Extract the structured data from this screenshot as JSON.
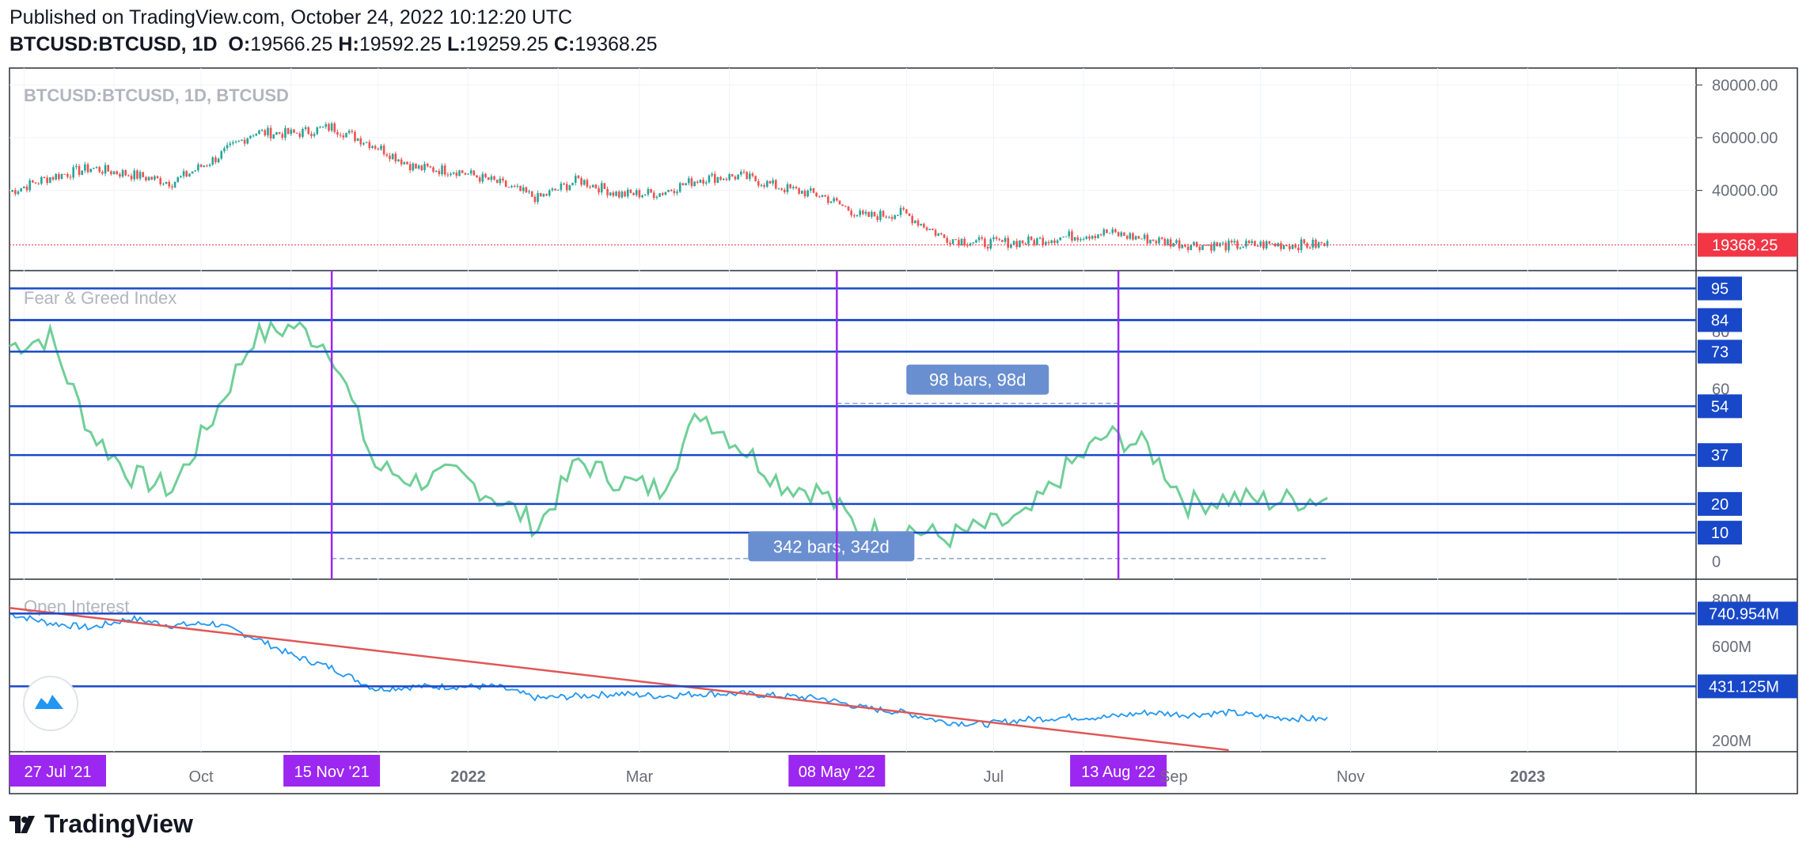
{
  "header": {
    "published": "Published on TradingView.com, October 24, 2022 10:12:20 UTC",
    "symbol": "BTCUSD:BTCUSD, 1D",
    "o_label": "O:",
    "o_value": "19566.25",
    "h_label": "H:",
    "h_value": "19592.25",
    "l_label": "L:",
    "l_value": "19259.25",
    "c_label": "C:",
    "c_value": "19368.25"
  },
  "footer": {
    "brand": "TradingView"
  },
  "colors": {
    "up": "#26a69a",
    "down": "#ef5350",
    "fg_line": "#6fcf97",
    "oi_line": "#2196f3",
    "hline": "#1848c8",
    "vline": "#9c27f0",
    "trend": "#e05656",
    "range_label": "#6a8fd0",
    "price_tag": "#f23645"
  },
  "chart_data": [
    {
      "type": "candlestick",
      "title": "BTCUSD:BTCUSD, 1D, BTCUSD",
      "y_ticks": [
        "80000.00",
        "60000.00",
        "40000.00"
      ],
      "ylim": [
        12000,
        84000
      ],
      "last_price": "19368.25",
      "x": [
        "2021-07-27",
        "2021-08-10",
        "2021-08-24",
        "2021-09-07",
        "2021-09-21",
        "2021-10-05",
        "2021-10-19",
        "2021-11-02",
        "2021-11-15",
        "2021-11-30",
        "2021-12-14",
        "2021-12-28",
        "2022-01-11",
        "2022-01-25",
        "2022-02-08",
        "2022-02-22",
        "2022-03-08",
        "2022-03-22",
        "2022-04-05",
        "2022-04-19",
        "2022-05-03",
        "2022-05-17",
        "2022-05-31",
        "2022-06-14",
        "2022-06-28",
        "2022-07-12",
        "2022-07-26",
        "2022-08-09",
        "2022-08-23",
        "2022-09-06",
        "2022-09-20",
        "2022-10-04",
        "2022-10-24"
      ],
      "close": [
        39500,
        45000,
        48500,
        46000,
        43000,
        51500,
        62000,
        61500,
        64000,
        57000,
        48500,
        47500,
        43000,
        37000,
        44000,
        38500,
        39000,
        44500,
        45500,
        41000,
        38000,
        30000,
        31500,
        22000,
        20000,
        20500,
        22500,
        24000,
        21500,
        19500,
        19000,
        19500,
        19368
      ]
    },
    {
      "type": "line",
      "title": "Fear & Greed Index",
      "y_ticks": [
        "80",
        "60",
        "0"
      ],
      "ylim": [
        -4,
        99
      ],
      "hlines": [
        "95",
        "84",
        "84",
        "73",
        "54",
        "37",
        "20",
        "10"
      ],
      "measurements": [
        "98 bars, 98d",
        "342 bars, 342d"
      ],
      "x": [
        "2021-07-27",
        "2021-08-10",
        "2021-08-24",
        "2021-09-07",
        "2021-09-21",
        "2021-10-05",
        "2021-10-19",
        "2021-11-02",
        "2021-11-15",
        "2021-11-30",
        "2021-12-14",
        "2021-12-28",
        "2022-01-11",
        "2022-01-25",
        "2022-02-08",
        "2022-02-22",
        "2022-03-08",
        "2022-03-22",
        "2022-04-05",
        "2022-04-19",
        "2022-05-03",
        "2022-05-17",
        "2022-05-31",
        "2022-06-14",
        "2022-06-28",
        "2022-07-12",
        "2022-07-26",
        "2022-08-09",
        "2022-08-23",
        "2022-09-06",
        "2022-09-20",
        "2022-10-04",
        "2022-10-24"
      ],
      "values": [
        75,
        78,
        45,
        30,
        25,
        50,
        78,
        82,
        74,
        33,
        28,
        30,
        22,
        12,
        35,
        28,
        25,
        52,
        40,
        27,
        24,
        10,
        12,
        8,
        12,
        15,
        32,
        44,
        40,
        20,
        22,
        21,
        22
      ]
    },
    {
      "type": "line",
      "title": "Open Interest",
      "y_ticks": [
        "800M",
        "600M",
        "200M"
      ],
      "ylim": [
        180000000,
        860000000
      ],
      "hlines": [
        "740.954M",
        "431.125M"
      ],
      "x": [
        "2021-07-27",
        "2021-08-10",
        "2021-08-24",
        "2021-09-07",
        "2021-09-21",
        "2021-10-05",
        "2021-10-19",
        "2021-11-02",
        "2021-11-15",
        "2021-11-30",
        "2021-12-14",
        "2021-12-28",
        "2022-01-11",
        "2022-01-25",
        "2022-02-08",
        "2022-02-22",
        "2022-03-08",
        "2022-03-22",
        "2022-04-05",
        "2022-04-19",
        "2022-05-03",
        "2022-05-17",
        "2022-05-31",
        "2022-06-14",
        "2022-06-28",
        "2022-07-12",
        "2022-07-26",
        "2022-08-09",
        "2022-08-23",
        "2022-09-06",
        "2022-09-20",
        "2022-10-04",
        "2022-10-24"
      ],
      "values": [
        740000000,
        700000000,
        680000000,
        720000000,
        690000000,
        700000000,
        640000000,
        560000000,
        510000000,
        420000000,
        430000000,
        430000000,
        430000000,
        380000000,
        390000000,
        400000000,
        390000000,
        400000000,
        400000000,
        390000000,
        380000000,
        340000000,
        320000000,
        280000000,
        270000000,
        290000000,
        300000000,
        300000000,
        320000000,
        310000000,
        320000000,
        300000000,
        290000000
      ]
    }
  ],
  "x_axis": {
    "ticks": [
      "Oct",
      "2022",
      "Mar",
      "Jul",
      "Sep",
      "Nov",
      "2023"
    ],
    "markers": [
      "27 Jul '21",
      "15 Nov '21",
      "08 May '22",
      "13 Aug '22"
    ]
  }
}
